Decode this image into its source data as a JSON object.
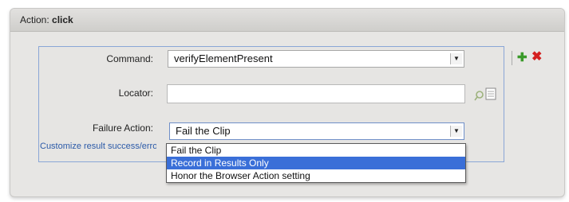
{
  "panel": {
    "title_prefix": "Action:",
    "title_value": "click"
  },
  "form": {
    "command": {
      "label": "Command:",
      "value": "verifyElementPresent"
    },
    "locator": {
      "label": "Locator:",
      "value": ""
    },
    "failure_action": {
      "label": "Failure Action:",
      "value": "Fail the Clip",
      "options": [
        "Fail the Clip",
        "Record in Results Only",
        "Honor the Browser Action setting"
      ],
      "highlighted_option": "Record in Results Only"
    },
    "customize_link": "Customize result success/error"
  },
  "actions": {
    "add_icon": "plus-icon",
    "delete_icon": "x-icon",
    "add_color": "#3a9a2a",
    "delete_color": "#d42020"
  }
}
